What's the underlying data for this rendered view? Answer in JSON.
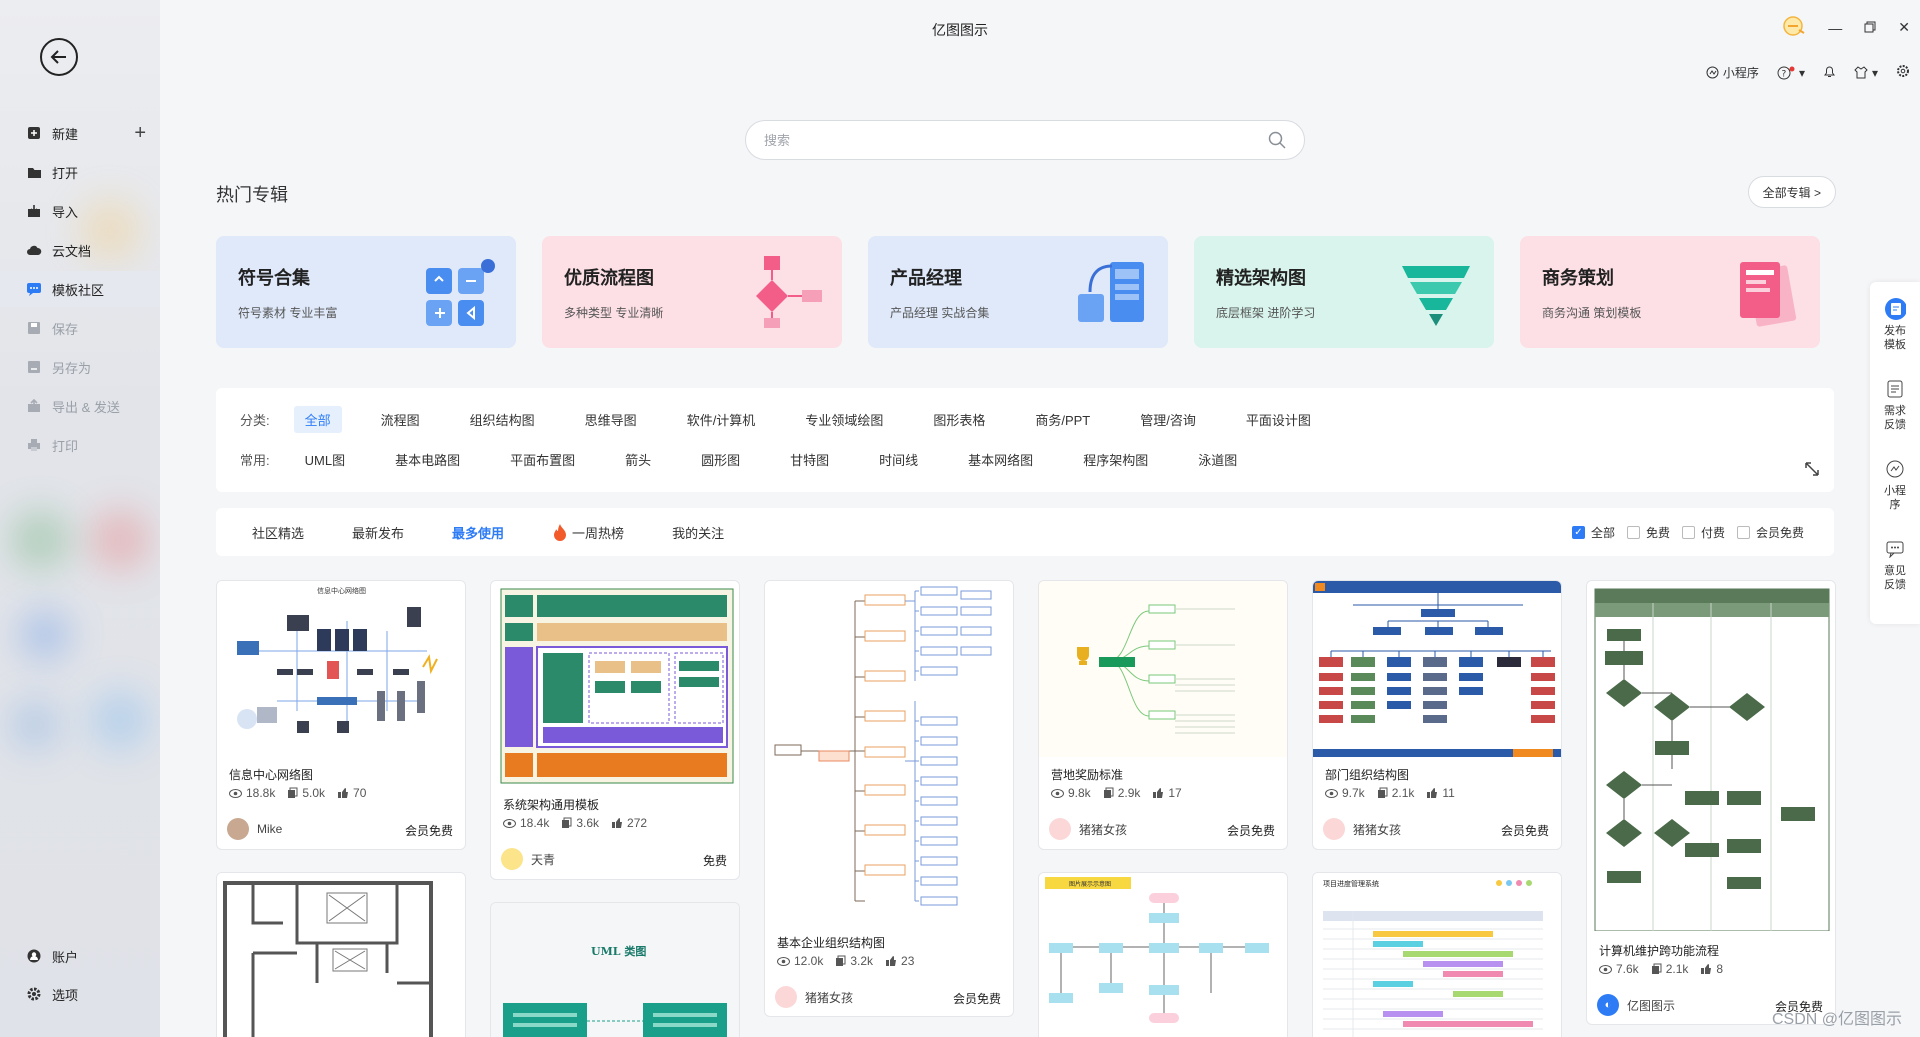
{
  "window": {
    "title": "亿图图示"
  },
  "toolbar": {
    "mini_program": "小程序"
  },
  "sidebar": {
    "items": [
      {
        "label": "新建",
        "icon": "plus-square-icon"
      },
      {
        "label": "打开",
        "icon": "folder-icon"
      },
      {
        "label": "导入",
        "icon": "import-icon"
      },
      {
        "label": "云文档",
        "icon": "cloud-icon"
      },
      {
        "label": "模板社区",
        "icon": "community-icon"
      },
      {
        "label": "保存",
        "icon": "save-icon"
      },
      {
        "label": "另存为",
        "icon": "save-as-icon"
      },
      {
        "label": "导出 & 发送",
        "icon": "export-icon"
      },
      {
        "label": "打印",
        "icon": "print-icon"
      }
    ],
    "bottom": [
      {
        "label": "账户",
        "icon": "user-icon"
      },
      {
        "label": "选项",
        "icon": "gear-icon"
      }
    ]
  },
  "search": {
    "placeholder": "搜索"
  },
  "hot": {
    "title": "热门专辑",
    "all_label": "全部专辑 >",
    "albums": [
      {
        "title": "符号合集",
        "subtitle": "符号素材 专业丰富",
        "bg": "#dfe9fa"
      },
      {
        "title": "优质流程图",
        "subtitle": "多种类型 专业清晰",
        "bg": "#fde0e6"
      },
      {
        "title": "产品经理",
        "subtitle": "产品经理 实战合集",
        "bg": "#dfe9fa"
      },
      {
        "title": "精选架构图",
        "subtitle": "底层框架 进阶学习",
        "bg": "#d8f4ec"
      },
      {
        "title": "商务策划",
        "subtitle": "商务沟通 策划模板",
        "bg": "#fde0e6"
      }
    ]
  },
  "filters": {
    "category_label": "分类:",
    "categories": [
      "全部",
      "流程图",
      "组织结构图",
      "思维导图",
      "软件/计算机",
      "专业领域绘图",
      "图形表格",
      "商务/PPT",
      "管理/咨询",
      "平面设计图"
    ],
    "common_label": "常用:",
    "common": [
      "UML图",
      "基本电路图",
      "平面布置图",
      "箭头",
      "圆形图",
      "甘特图",
      "时间线",
      "基本网络图",
      "程序架构图",
      "泳道图"
    ]
  },
  "tabs": {
    "items": [
      "社区精选",
      "最新发布",
      "最多使用",
      "一周热榜",
      "我的关注"
    ],
    "checks": [
      "全部",
      "免费",
      "付费",
      "会员免费"
    ]
  },
  "cards": [
    {
      "name": "信息中心网络图",
      "views": "18.8k",
      "copies": "5.0k",
      "likes": "70",
      "author": "Mike",
      "price": "会员免费"
    },
    {
      "name": "系统架构通用模板",
      "views": "18.4k",
      "copies": "3.6k",
      "likes": "272",
      "author": "天青",
      "price": "免费"
    },
    {
      "name": "基本企业组织结构图",
      "views": "12.0k",
      "copies": "3.2k",
      "likes": "23",
      "author": "猪猪女孩",
      "price": "会员免费"
    },
    {
      "name": "营地奖励标准",
      "views": "9.8k",
      "copies": "2.9k",
      "likes": "17",
      "author": "猪猪女孩",
      "price": "会员免费"
    },
    {
      "name": "部门组织结构图",
      "views": "9.7k",
      "copies": "2.1k",
      "likes": "11",
      "author": "猪猪女孩",
      "price": "会员免费"
    },
    {
      "name": "计算机维护跨功能流程",
      "views": "7.6k",
      "copies": "2.1k",
      "likes": "8",
      "author": "亿图图示",
      "price": "会员免费"
    }
  ],
  "thumb_text": {
    "network_title": "信息中心网络图",
    "uml_title": "UML 类图",
    "gantt_title": "项目进度管理系统",
    "floor_plan_title": "图片展示示意图"
  },
  "right_panel": [
    {
      "label": "发布模板",
      "icon": "publish-icon"
    },
    {
      "label": "需求反馈",
      "icon": "request-icon"
    },
    {
      "label": "小程序",
      "icon": "mini-program-icon"
    },
    {
      "label": "意见反馈",
      "icon": "feedback-icon"
    }
  ],
  "watermark": "CSDN @亿图图示"
}
